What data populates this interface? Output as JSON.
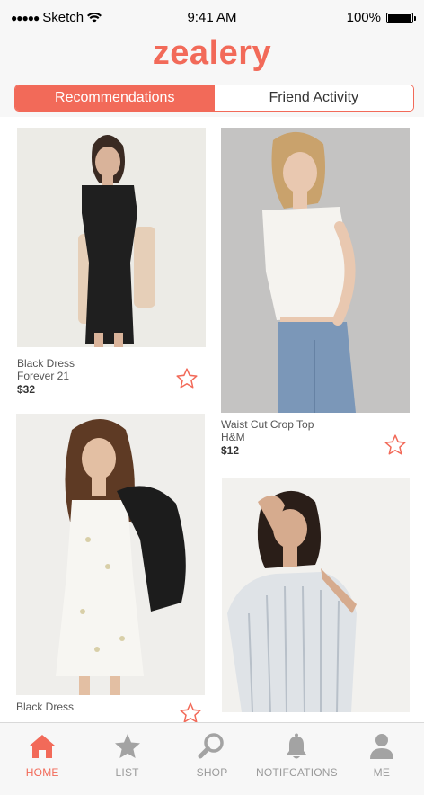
{
  "status_bar": {
    "carrier": "Sketch",
    "time": "9:41 AM",
    "battery": "100%"
  },
  "app": {
    "logo": "zealery"
  },
  "segments": {
    "recommendations": "Recommendations",
    "friend_activity": "Friend Activity",
    "selected": "Recommendations"
  },
  "products": [
    {
      "title": "Black Dress",
      "brand": "Forever 21",
      "price": "$32"
    },
    {
      "title": "Waist Cut Crop Top",
      "brand": "H&M",
      "price": "$12"
    },
    {
      "title": "Black Dress"
    }
  ],
  "tabs": [
    {
      "label": "HOME",
      "icon": "home-icon",
      "active": true
    },
    {
      "label": "LIST",
      "icon": "star-icon"
    },
    {
      "label": "SHOP",
      "icon": "search-icon"
    },
    {
      "label": "NOTIFCATIONS",
      "icon": "bell-icon"
    },
    {
      "label": "ME",
      "icon": "person-icon"
    }
  ],
  "colors": {
    "accent": "#f26a59",
    "inactive": "#9a9a9a",
    "bar_background": "#f7f7f7"
  }
}
